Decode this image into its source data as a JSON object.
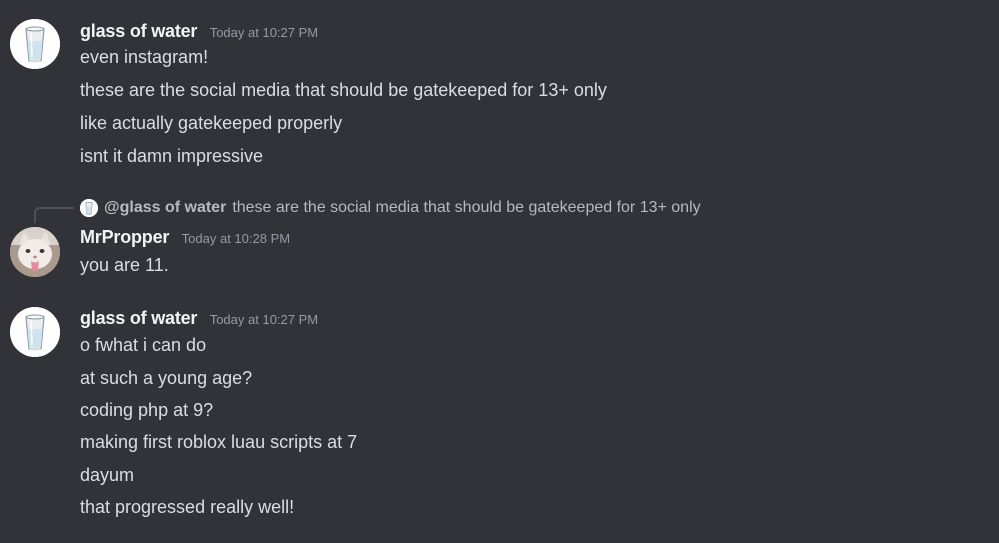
{
  "messages": [
    {
      "author": "glass of water",
      "timestamp": "Today at 10:27 PM",
      "avatar_icon": "glass-of-water-icon",
      "lines": [
        "even instagram!",
        "these are the social media that should be gatekeeped for 13+ only",
        "like actually gatekeeped properly",
        "isnt it damn impressive"
      ]
    },
    {
      "reply": {
        "author": "@glass of water",
        "text": "these are the social media that should be gatekeeped for 13+ only"
      },
      "author": "MrPropper",
      "timestamp": "Today at 10:28 PM",
      "avatar_icon": "cat-avatar-icon",
      "lines": [
        "you are 11."
      ]
    },
    {
      "author": "glass of water",
      "timestamp": "Today at 10:27 PM",
      "avatar_icon": "glass-of-water-icon",
      "lines": [
        "o fwhat i can do",
        "at such a young age?",
        "coding php at 9?",
        "making first roblox luau scripts at 7",
        "dayum",
        "that progressed really well!"
      ]
    }
  ],
  "colors": {
    "background": "#313338",
    "username": "#f2f3f5",
    "timestamp": "#949ba4",
    "message_text": "#dbdee1",
    "reply_text": "#b5bac1"
  }
}
